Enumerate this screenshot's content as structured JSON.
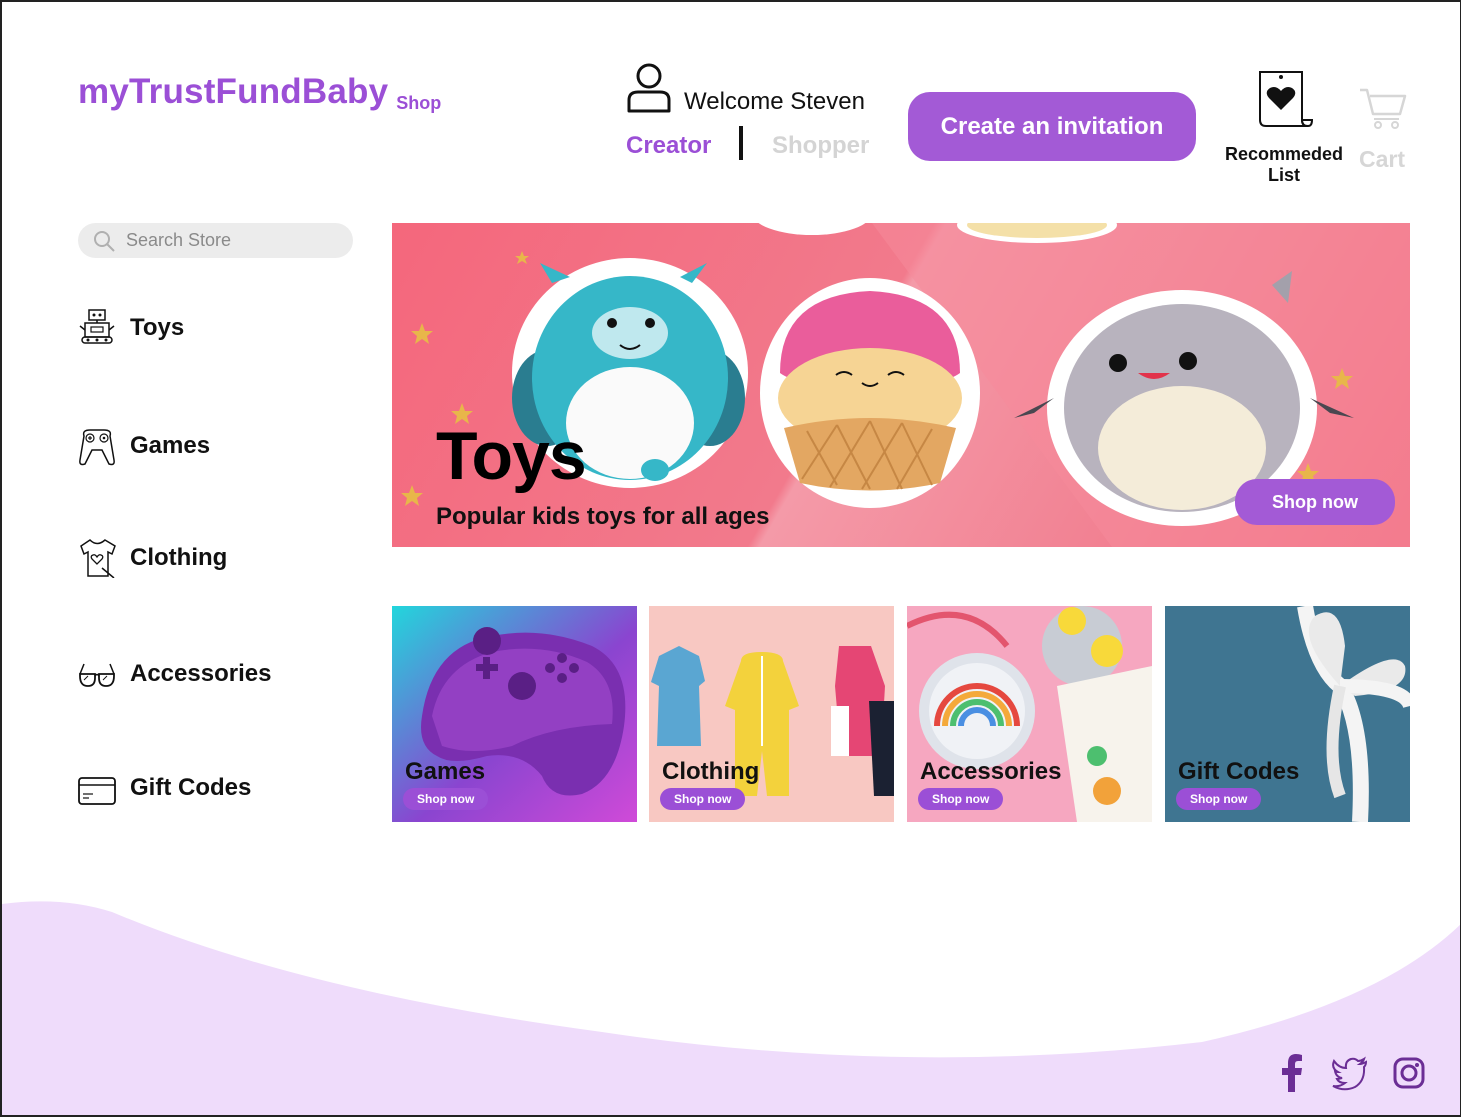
{
  "header": {
    "brand_name": "myTrustFundBaby",
    "brand_sub": "Shop",
    "welcome": "Welcome Steven",
    "role_creator": "Creator",
    "role_shopper": "Shopper",
    "invite_button": "Create an invitation",
    "recommended_label": "Recommeded List",
    "cart_label": "Cart"
  },
  "search": {
    "placeholder": "Search Store"
  },
  "sidebar": {
    "items": [
      {
        "label": "Toys",
        "icon": "robot-icon"
      },
      {
        "label": "Games",
        "icon": "gamepad-icon"
      },
      {
        "label": "Clothing",
        "icon": "shirt-icon"
      },
      {
        "label": "Accessories",
        "icon": "glasses-icon"
      },
      {
        "label": "Gift Codes",
        "icon": "card-icon"
      }
    ]
  },
  "hero": {
    "title": "Toys",
    "subtitle": "Popular kids toys for all ages",
    "button": "Shop now"
  },
  "categories": [
    {
      "label": "Games",
      "button": "Shop now"
    },
    {
      "label": "Clothing",
      "button": "Shop now"
    },
    {
      "label": "Accessories",
      "button": "Shop now"
    },
    {
      "label": "Gift Codes",
      "button": "Shop now"
    }
  ],
  "footer": {
    "social": [
      "facebook-icon",
      "twitter-icon",
      "instagram-icon"
    ],
    "color": "#efdcfb"
  },
  "colors": {
    "accent": "#9b4fd6",
    "button": "#a35ad6",
    "disabled": "#d4d4d4"
  }
}
